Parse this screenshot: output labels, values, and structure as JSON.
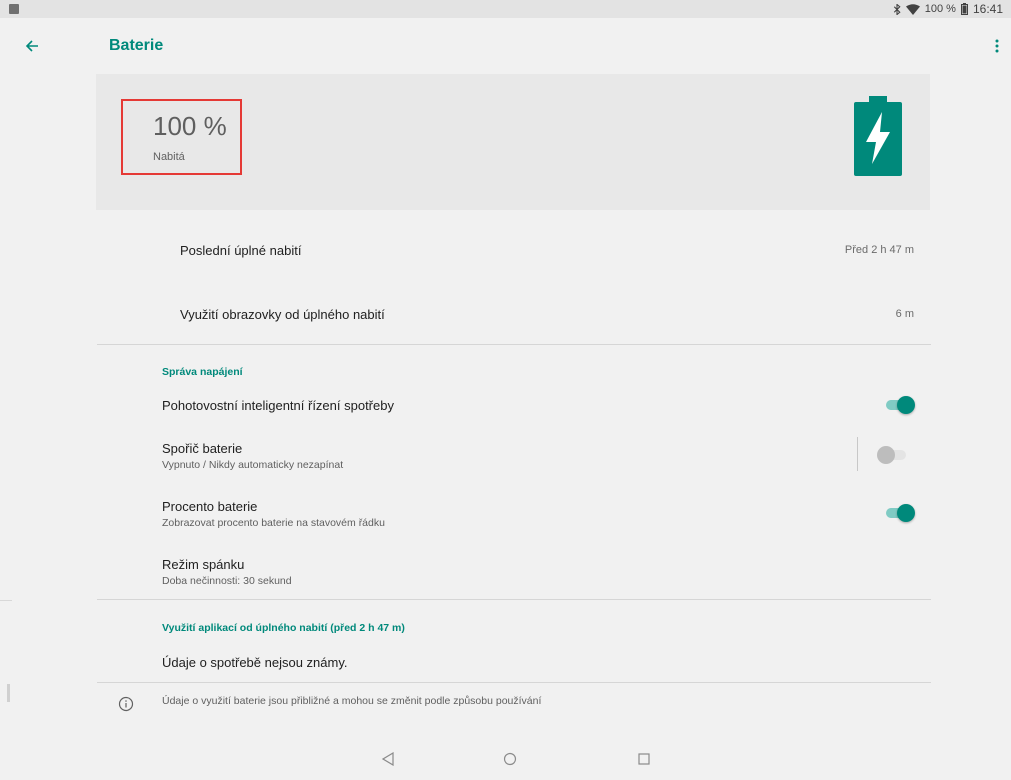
{
  "status_bar": {
    "battery_percent": "100 %",
    "time": "16:41",
    "icons": [
      "bluetooth-icon",
      "wifi-icon",
      "battery-icon"
    ]
  },
  "app_bar": {
    "title": "Baterie",
    "icons": [
      "back-arrow-icon",
      "overflow-menu-icon"
    ]
  },
  "header": {
    "percent": "100 %",
    "status": "Nabitá",
    "icon": "battery-charging-icon",
    "accent_color": "#00897b",
    "highlight_color": "#e53935"
  },
  "stats": [
    {
      "label": "Poslední úplné nabití",
      "value": "Před 2 h 47 m"
    },
    {
      "label": "Využití obrazovky od úplného nabití",
      "value": "6 m"
    }
  ],
  "power_section": {
    "heading": "Správa napájení",
    "items": [
      {
        "label": "Pohotovostní inteligentní řízení spotřeby",
        "summary": "",
        "toggle": true
      },
      {
        "label": "Spořič baterie",
        "summary": "Vypnuto / Nikdy automaticky nezapínat",
        "toggle": false
      },
      {
        "label": "Procento baterie",
        "summary": "Zobrazovat procento baterie na stavovém řádku",
        "toggle": true
      },
      {
        "label": "Režim spánku",
        "summary": "Doba nečinnosti: 30 sekund"
      }
    ]
  },
  "usage_section": {
    "heading": "Využití aplikací od úplného nabití (před 2 h 47 m)",
    "text": "Údaje o spotřebě nejsou známy."
  },
  "footer_note": {
    "icon": "info-icon",
    "text": "Údaje o využití baterie jsou přibližné a mohou se změnit podle způsobu používání"
  },
  "nav_bar": {
    "icons": [
      "nav-back-icon",
      "nav-home-icon",
      "nav-recents-icon"
    ]
  }
}
